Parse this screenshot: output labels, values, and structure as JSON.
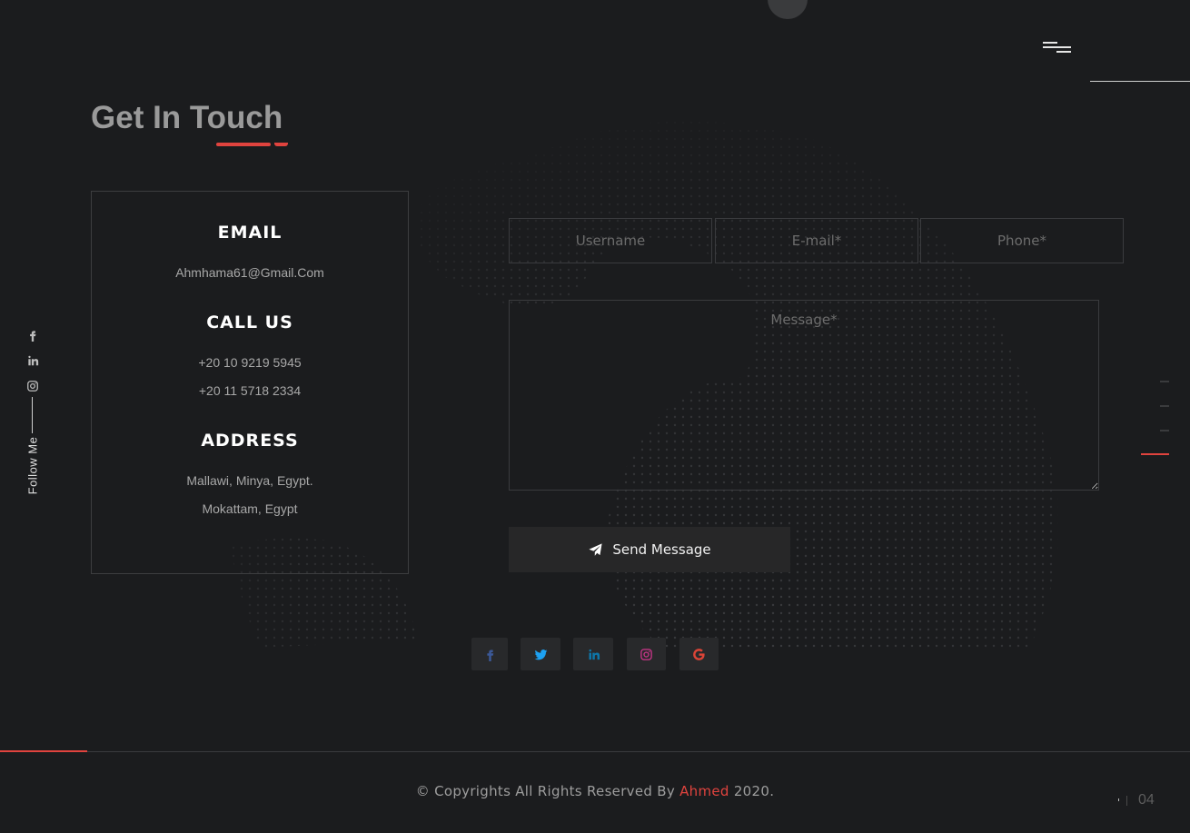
{
  "header": {
    "menu_icon": "hamburger-icon"
  },
  "section": {
    "title": "Get In Touch"
  },
  "follow": {
    "label": "Follow Me",
    "icons": [
      "facebook-icon",
      "linkedin-icon",
      "instagram-icon"
    ]
  },
  "contact_info": {
    "email_heading": "EMAIL",
    "email": "Ahmhama61@Gmail.Com",
    "call_heading": "CALL US",
    "phone_1": "+20 10 9219 5945",
    "phone_2": "+20 11 5718 2334",
    "address_heading": "ADDRESS",
    "address_1": "Mallawi, Minya, Egypt.",
    "address_2": "Mokattam, Egypt"
  },
  "form": {
    "username_placeholder": "Username",
    "email_placeholder": "E-mail*",
    "phone_placeholder": "Phone*",
    "message_placeholder": "Message*",
    "send_label": "Send Message"
  },
  "social_links": [
    {
      "icon": "facebook-icon",
      "color": "#3b5998"
    },
    {
      "icon": "twitter-icon",
      "color": "#1da1f2"
    },
    {
      "icon": "linkedin-icon",
      "color": "#0e76a8"
    },
    {
      "icon": "instagram-icon",
      "color": "#c13584"
    },
    {
      "icon": "google-icon",
      "color": "#db4437"
    }
  ],
  "footer": {
    "copyright_prefix": "© Copyrights All Rights Reserved By",
    "author": "Ahmed",
    "year": "2020.",
    "page_number": "04"
  },
  "colors": {
    "accent": "#e0433e",
    "background": "#1b1c1e"
  }
}
